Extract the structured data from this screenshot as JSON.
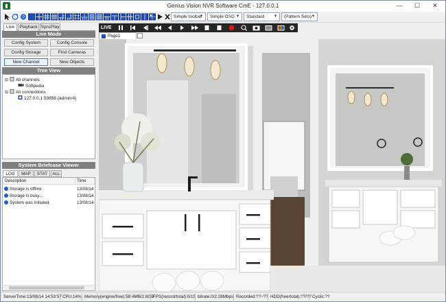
{
  "window": {
    "title": "Genius Vision NVR Software CmE - 127.0.0.1",
    "controls": [
      "minimize-icon",
      "maximize-icon",
      "close-icon"
    ]
  },
  "toolbar": {
    "toolbar_select": "Simple toolbar",
    "osd_select": "Simple OSD",
    "profile_select": "Standard",
    "pattern_select": "(Pattern Sets)"
  },
  "mode_tabs": [
    "Live",
    "Playback",
    "SyncPlay"
  ],
  "live_mode": {
    "header": "Live Mode",
    "buttons": [
      "Config System",
      "Config Console",
      "Config Storage",
      "Find Cameras",
      "New Channel",
      "New Objects"
    ]
  },
  "tree_view": {
    "header": "Tree View",
    "items": [
      {
        "label": "All channels",
        "level": 0
      },
      {
        "label": "Softpedia",
        "level": 1
      },
      {
        "label": "All connections",
        "level": 0
      },
      {
        "label": "127.0.0.1:59858 (admin/4)",
        "level": 1
      }
    ]
  },
  "briefcase": {
    "header": "System Briefcase Viewer",
    "tabs": [
      "LOG",
      "MAP",
      "STAT",
      "ALL"
    ],
    "columns": [
      "Description",
      "Time"
    ],
    "rows": [
      {
        "description": "Storage is offline",
        "time": "13/08/14"
      },
      {
        "description": "Storage is busy....",
        "time": "13/08/14"
      },
      {
        "description": "System was initiated.",
        "time": "13/08/14"
      }
    ]
  },
  "live_bar": {
    "label": "LIVE",
    "controls": [
      "pause-icon",
      "first-frame-icon",
      "step-back-icon",
      "rewind-icon",
      "prev-icon",
      "play-icon",
      "next-icon",
      "stop-icon",
      "record-icon",
      "zoom-icon",
      "snapshot-icon",
      "image-icon",
      "color-icon",
      "settings-icon"
    ]
  },
  "page_tab": {
    "label": "Page1"
  },
  "status_bar": {
    "server_time": "ServerTime:13/08/14 14:53:57",
    "cpu": "CPU:14%",
    "memory": "Memory(engine/free):58.4MB/2.8GB",
    "fps": "FPS(record/total):0/15",
    "bitrate": "bitrate:0/2.28Mbps",
    "recorded": "Recorded:??~??",
    "hdd": "HDD(free/total):??/??",
    "cyclic": "Cyclic:??"
  },
  "colors": {
    "accent": "#1b6f2b",
    "section_header": "#7f7f7f",
    "live_bar": "#262626",
    "record": "#e01818"
  }
}
